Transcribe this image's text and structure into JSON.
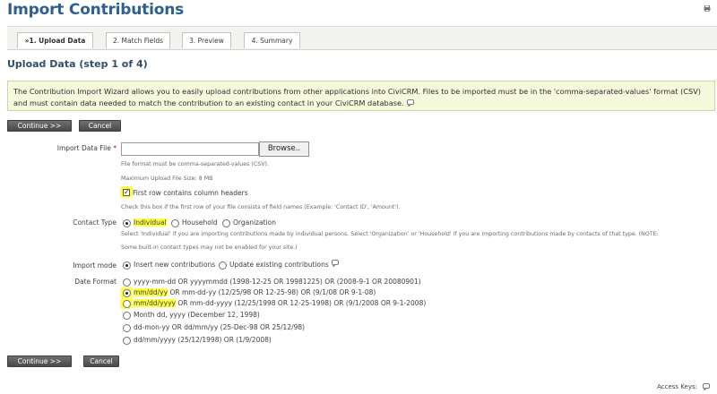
{
  "page": {
    "title": "Import Contributions",
    "print_icon": "print-icon"
  },
  "wizard": {
    "tabs": [
      {
        "label": "»1. Upload Data",
        "active": true
      },
      {
        "label": "2. Match Fields",
        "active": false
      },
      {
        "label": "3. Preview",
        "active": false
      },
      {
        "label": "4. Summary",
        "active": false
      }
    ],
    "step_heading": "Upload Data (step 1 of 4)"
  },
  "help": {
    "line1": "The Contribution Import Wizard allows you to easily upload contributions from other applications into CiviCRM. Files to be imported must be in the 'comma-separated-values' format (CSV)",
    "line2": "and must contain data needed to match the contribution to an existing contact in your CiviCRM database.",
    "icon": "help-icon"
  },
  "buttons": {
    "continue": "Continue >>",
    "cancel": "Cancel"
  },
  "form": {
    "import_file": {
      "label": "Import Data File",
      "required_mark": "*",
      "browse": "Browse..",
      "value": "",
      "desc_format": "File format must be comma-separated-values (CSV).",
      "max_size": "Maximum Upload File Size: 8 MB"
    },
    "headers": {
      "label": "First row contains column headers",
      "checked": true,
      "desc": "Check this box if the first row of your file consists of field names (Example: 'Contact ID', 'Amount')."
    },
    "contact_type": {
      "label": "Contact Type",
      "options": [
        {
          "label": "Individual",
          "selected": true
        },
        {
          "label": "Household",
          "selected": false
        },
        {
          "label": "Organization",
          "selected": false
        }
      ],
      "desc1": "Select 'Individual' if you are importing contributions made by individual persons. Select 'Organization' or 'Household' if you are importing contributions made by contacts of that type. (NOTE:",
      "desc2": "Some built-in contact types may not be enabled for your site.)"
    },
    "import_mode": {
      "label": "Import mode",
      "options": [
        {
          "label": "Insert new contributions",
          "selected": true
        },
        {
          "label": "Update existing contributions",
          "selected": false
        }
      ],
      "help_icon": "help-icon"
    },
    "date_format": {
      "label": "Date Format",
      "options": [
        {
          "prefix": "yyyy-mm-dd OR yyyymmdd (1998-12-25 OR 19981225) OR (2008-9-1 OR 20080901)",
          "highlight": "",
          "selected": false
        },
        {
          "highlight": "mm/dd/yy",
          "prefix": " OR mm-dd-yy (12/25/98 OR 12-25-98) OR (9/1/08 OR 9-1-08)",
          "selected": true
        },
        {
          "highlight": "mm/dd/yyyy",
          "prefix": " OR mm-dd-yyyy (12/25/1998 OR 12-25-1998) OR (9/1/2008 OR 9-1-2008)",
          "selected": false
        },
        {
          "prefix": "Month dd, yyyy (December 12, 1998)",
          "highlight": "",
          "selected": false
        },
        {
          "prefix": "dd-mon-yy OR dd/mm/yy (25-Dec-98 OR 25/12/98)",
          "highlight": "",
          "selected": false
        },
        {
          "prefix": "dd/mm/yyyy (25/12/1998) OR (1/9/2008)",
          "highlight": "",
          "selected": false
        }
      ]
    }
  },
  "footer": {
    "access_keys": "Access Keys:",
    "icon": "help-icon"
  },
  "colors": {
    "title": "#2f5f8f",
    "highlight": "#ffff44",
    "help_bg": "#f7f9dc",
    "button": "#555555"
  }
}
